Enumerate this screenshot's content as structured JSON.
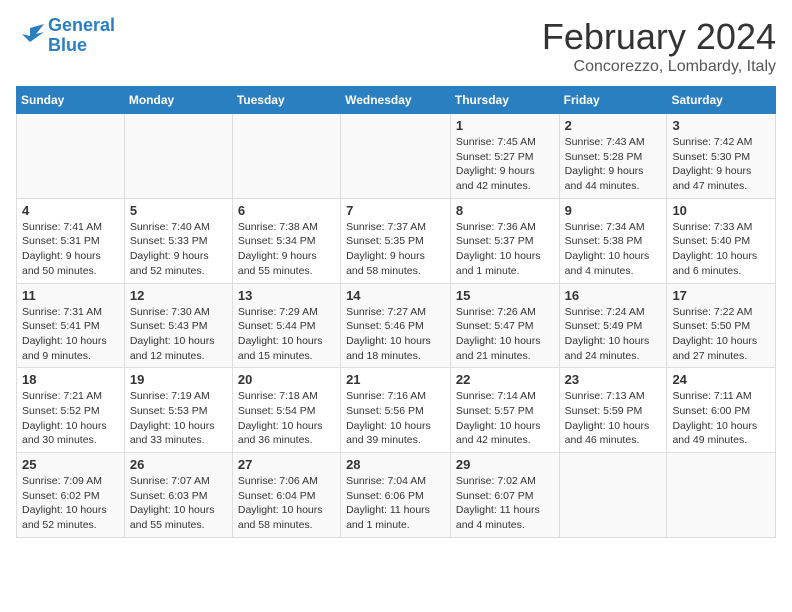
{
  "logo": {
    "line1": "General",
    "line2": "Blue"
  },
  "title": "February 2024",
  "location": "Concorezzo, Lombardy, Italy",
  "headers": [
    "Sunday",
    "Monday",
    "Tuesday",
    "Wednesday",
    "Thursday",
    "Friday",
    "Saturday"
  ],
  "weeks": [
    [
      {
        "day": "",
        "info": ""
      },
      {
        "day": "",
        "info": ""
      },
      {
        "day": "",
        "info": ""
      },
      {
        "day": "",
        "info": ""
      },
      {
        "day": "1",
        "info": "Sunrise: 7:45 AM\nSunset: 5:27 PM\nDaylight: 9 hours\nand 42 minutes."
      },
      {
        "day": "2",
        "info": "Sunrise: 7:43 AM\nSunset: 5:28 PM\nDaylight: 9 hours\nand 44 minutes."
      },
      {
        "day": "3",
        "info": "Sunrise: 7:42 AM\nSunset: 5:30 PM\nDaylight: 9 hours\nand 47 minutes."
      }
    ],
    [
      {
        "day": "4",
        "info": "Sunrise: 7:41 AM\nSunset: 5:31 PM\nDaylight: 9 hours\nand 50 minutes."
      },
      {
        "day": "5",
        "info": "Sunrise: 7:40 AM\nSunset: 5:33 PM\nDaylight: 9 hours\nand 52 minutes."
      },
      {
        "day": "6",
        "info": "Sunrise: 7:38 AM\nSunset: 5:34 PM\nDaylight: 9 hours\nand 55 minutes."
      },
      {
        "day": "7",
        "info": "Sunrise: 7:37 AM\nSunset: 5:35 PM\nDaylight: 9 hours\nand 58 minutes."
      },
      {
        "day": "8",
        "info": "Sunrise: 7:36 AM\nSunset: 5:37 PM\nDaylight: 10 hours\nand 1 minute."
      },
      {
        "day": "9",
        "info": "Sunrise: 7:34 AM\nSunset: 5:38 PM\nDaylight: 10 hours\nand 4 minutes."
      },
      {
        "day": "10",
        "info": "Sunrise: 7:33 AM\nSunset: 5:40 PM\nDaylight: 10 hours\nand 6 minutes."
      }
    ],
    [
      {
        "day": "11",
        "info": "Sunrise: 7:31 AM\nSunset: 5:41 PM\nDaylight: 10 hours\nand 9 minutes."
      },
      {
        "day": "12",
        "info": "Sunrise: 7:30 AM\nSunset: 5:43 PM\nDaylight: 10 hours\nand 12 minutes."
      },
      {
        "day": "13",
        "info": "Sunrise: 7:29 AM\nSunset: 5:44 PM\nDaylight: 10 hours\nand 15 minutes."
      },
      {
        "day": "14",
        "info": "Sunrise: 7:27 AM\nSunset: 5:46 PM\nDaylight: 10 hours\nand 18 minutes."
      },
      {
        "day": "15",
        "info": "Sunrise: 7:26 AM\nSunset: 5:47 PM\nDaylight: 10 hours\nand 21 minutes."
      },
      {
        "day": "16",
        "info": "Sunrise: 7:24 AM\nSunset: 5:49 PM\nDaylight: 10 hours\nand 24 minutes."
      },
      {
        "day": "17",
        "info": "Sunrise: 7:22 AM\nSunset: 5:50 PM\nDaylight: 10 hours\nand 27 minutes."
      }
    ],
    [
      {
        "day": "18",
        "info": "Sunrise: 7:21 AM\nSunset: 5:52 PM\nDaylight: 10 hours\nand 30 minutes."
      },
      {
        "day": "19",
        "info": "Sunrise: 7:19 AM\nSunset: 5:53 PM\nDaylight: 10 hours\nand 33 minutes."
      },
      {
        "day": "20",
        "info": "Sunrise: 7:18 AM\nSunset: 5:54 PM\nDaylight: 10 hours\nand 36 minutes."
      },
      {
        "day": "21",
        "info": "Sunrise: 7:16 AM\nSunset: 5:56 PM\nDaylight: 10 hours\nand 39 minutes."
      },
      {
        "day": "22",
        "info": "Sunrise: 7:14 AM\nSunset: 5:57 PM\nDaylight: 10 hours\nand 42 minutes."
      },
      {
        "day": "23",
        "info": "Sunrise: 7:13 AM\nSunset: 5:59 PM\nDaylight: 10 hours\nand 46 minutes."
      },
      {
        "day": "24",
        "info": "Sunrise: 7:11 AM\nSunset: 6:00 PM\nDaylight: 10 hours\nand 49 minutes."
      }
    ],
    [
      {
        "day": "25",
        "info": "Sunrise: 7:09 AM\nSunset: 6:02 PM\nDaylight: 10 hours\nand 52 minutes."
      },
      {
        "day": "26",
        "info": "Sunrise: 7:07 AM\nSunset: 6:03 PM\nDaylight: 10 hours\nand 55 minutes."
      },
      {
        "day": "27",
        "info": "Sunrise: 7:06 AM\nSunset: 6:04 PM\nDaylight: 10 hours\nand 58 minutes."
      },
      {
        "day": "28",
        "info": "Sunrise: 7:04 AM\nSunset: 6:06 PM\nDaylight: 11 hours\nand 1 minute."
      },
      {
        "day": "29",
        "info": "Sunrise: 7:02 AM\nSunset: 6:07 PM\nDaylight: 11 hours\nand 4 minutes."
      },
      {
        "day": "",
        "info": ""
      },
      {
        "day": "",
        "info": ""
      }
    ]
  ]
}
